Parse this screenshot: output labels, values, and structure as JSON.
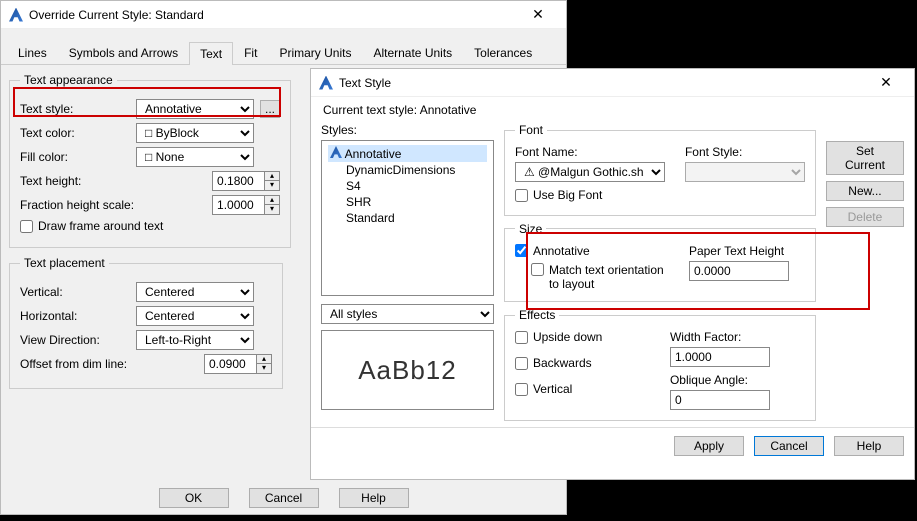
{
  "dlg1": {
    "title": "Override Current Style: Standard",
    "tabs": [
      "Lines",
      "Symbols and Arrows",
      "Text",
      "Fit",
      "Primary Units",
      "Alternate Units",
      "Tolerances"
    ],
    "activeTab": "Text",
    "appearance": {
      "legend": "Text appearance",
      "textStyleLabel": "Text style:",
      "textStyleValue": "Annotative",
      "textColorLabel": "Text color:",
      "textColorValue": "ByBlock",
      "fillColorLabel": "Fill color:",
      "fillColorValue": "None",
      "textHeightLabel": "Text height:",
      "textHeightValue": "0.1800",
      "fractionLabel": "Fraction height scale:",
      "fractionValue": "1.0000",
      "drawFrameLabel": "Draw frame around text"
    },
    "placement": {
      "legend": "Text placement",
      "verticalLabel": "Vertical:",
      "verticalValue": "Centered",
      "horizontalLabel": "Horizontal:",
      "horizontalValue": "Centered",
      "viewDirLabel": "View Direction:",
      "viewDirValue": "Left-to-Right",
      "offsetLabel": "Offset from dim line:",
      "offsetValue": "0.0900"
    },
    "buttons": {
      "ok": "OK",
      "cancel": "Cancel",
      "help": "Help"
    }
  },
  "dlg2": {
    "title": "Text Style",
    "currentLabel": "Current text style:  Annotative",
    "stylesLabel": "Styles:",
    "styles": [
      "Annotative",
      "DynamicDimensions",
      "S4",
      "SHR",
      "Standard"
    ],
    "selected": "Annotative",
    "filterValue": "All styles",
    "preview": "AaBb12",
    "font": {
      "legend": "Font",
      "fontNameLabel": "Font Name:",
      "fontNameValue": "@Malgun Gothic.shx",
      "fontStyleLabel": "Font Style:",
      "bigFontLabel": "Use Big Font"
    },
    "size": {
      "legend": "Size",
      "annotativeLabel": "Annotative",
      "matchLabel": "Match text orientation to layout",
      "paperHeightLabel": "Paper Text Height",
      "paperHeightValue": "0.0000"
    },
    "effects": {
      "legend": "Effects",
      "upsideLabel": "Upside down",
      "backwardsLabel": "Backwards",
      "verticalLabel": "Vertical",
      "widthLabel": "Width Factor:",
      "widthValue": "1.0000",
      "obliqueLabel": "Oblique Angle:",
      "obliqueValue": "0"
    },
    "rightButtons": {
      "setCurrent": "Set Current",
      "new": "New...",
      "delete": "Delete"
    },
    "buttons": {
      "apply": "Apply",
      "cancel": "Cancel",
      "help": "Help"
    }
  }
}
